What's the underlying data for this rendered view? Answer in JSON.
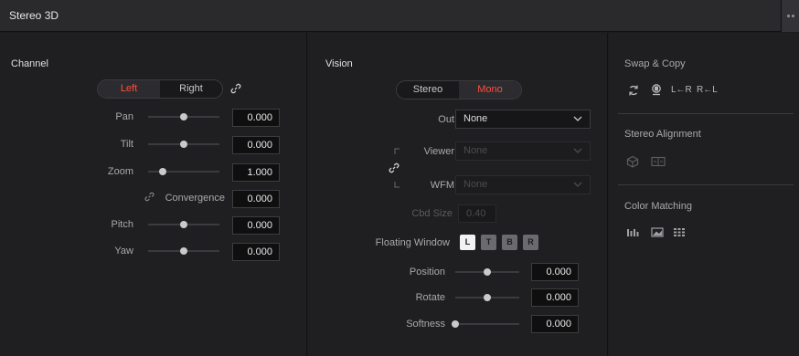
{
  "header": {
    "title": "Stereo 3D"
  },
  "channel": {
    "title": "Channel",
    "eyes": [
      {
        "label": "Left",
        "active": true
      },
      {
        "label": "Right",
        "active": false
      }
    ],
    "rows": [
      {
        "label": "Pan",
        "value": "0.000",
        "slider": 0.5
      },
      {
        "label": "Tilt",
        "value": "0.000",
        "slider": 0.5
      },
      {
        "label": "Zoom",
        "value": "1.000",
        "slider": 0.2
      },
      {
        "label": "Convergence",
        "value": "0.000"
      },
      {
        "label": "Pitch",
        "value": "0.000",
        "slider": 0.5
      },
      {
        "label": "Yaw",
        "value": "0.000",
        "slider": 0.5
      }
    ]
  },
  "vision": {
    "title": "Vision",
    "modes": [
      {
        "label": "Stereo",
        "active": false
      },
      {
        "label": "Mono",
        "active": true
      }
    ],
    "out": {
      "label": "Out",
      "value": "None"
    },
    "viewer": {
      "label": "Viewer",
      "value": "None"
    },
    "wfm": {
      "label": "WFM",
      "value": "None"
    },
    "cbd": {
      "label": "Cbd Size",
      "value": "0.40"
    },
    "floating": {
      "label": "Floating Window",
      "toggles": [
        {
          "letter": "L",
          "on": true
        },
        {
          "letter": "T",
          "on": false
        },
        {
          "letter": "B",
          "on": false
        },
        {
          "letter": "R",
          "on": false
        }
      ]
    },
    "rows": [
      {
        "label": "Position",
        "value": "0.000",
        "slider": 0.5
      },
      {
        "label": "Rotate",
        "value": "0.000",
        "slider": 0.5
      },
      {
        "label": "Softness",
        "value": "0.000",
        "slider": 0.0
      }
    ]
  },
  "right": {
    "swap_title": "Swap & Copy",
    "copy_lr": "L←R",
    "copy_rl": "R←L",
    "align_title": "Stereo Alignment",
    "color_title": "Color Matching"
  },
  "colors": {
    "accent": "#ff4e3c",
    "panel": "#1f1f21",
    "field": "#0f0f10"
  }
}
